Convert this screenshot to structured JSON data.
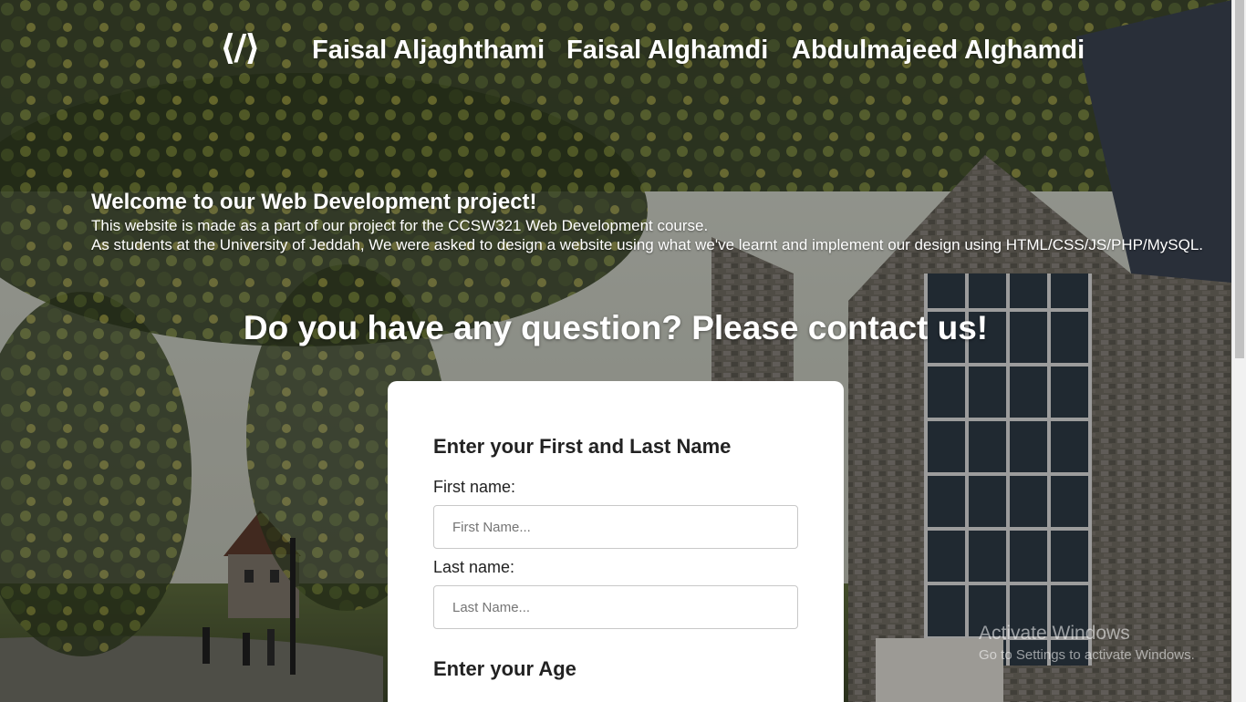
{
  "nav": {
    "logo": "⟨/⟩",
    "links": [
      "Faisal Aljaghthami",
      "Faisal Alghamdi",
      "Abdulmajeed Alghamdi"
    ]
  },
  "welcome": {
    "heading": "Welcome to our Web Development project!",
    "line1": "This website is made as a part of our project for the CCSW321 Web Development course.",
    "line2": "As students at the University of Jeddah, We were asked to design a website using what we've learnt and implement our design using HTML/CSS/JS/PHP/MySQL."
  },
  "contact": {
    "title": "Do you have any question? Please contact us!"
  },
  "form": {
    "name_section_title": "Enter your First and Last Name",
    "first_name_label": "First name:",
    "first_name_placeholder": "First Name...",
    "first_name_value": "",
    "last_name_label": "Last name:",
    "last_name_placeholder": "Last Name...",
    "last_name_value": "",
    "age_section_title": "Enter your Age"
  },
  "watermark": {
    "title": "Activate Windows",
    "subtitle": "Go to Settings to activate Windows."
  },
  "colors": {
    "text_on_photo": "#ffffff",
    "card_background": "#ffffff",
    "input_border": "#c8c8c8",
    "scrollbar_thumb": "#c1c1c1"
  }
}
